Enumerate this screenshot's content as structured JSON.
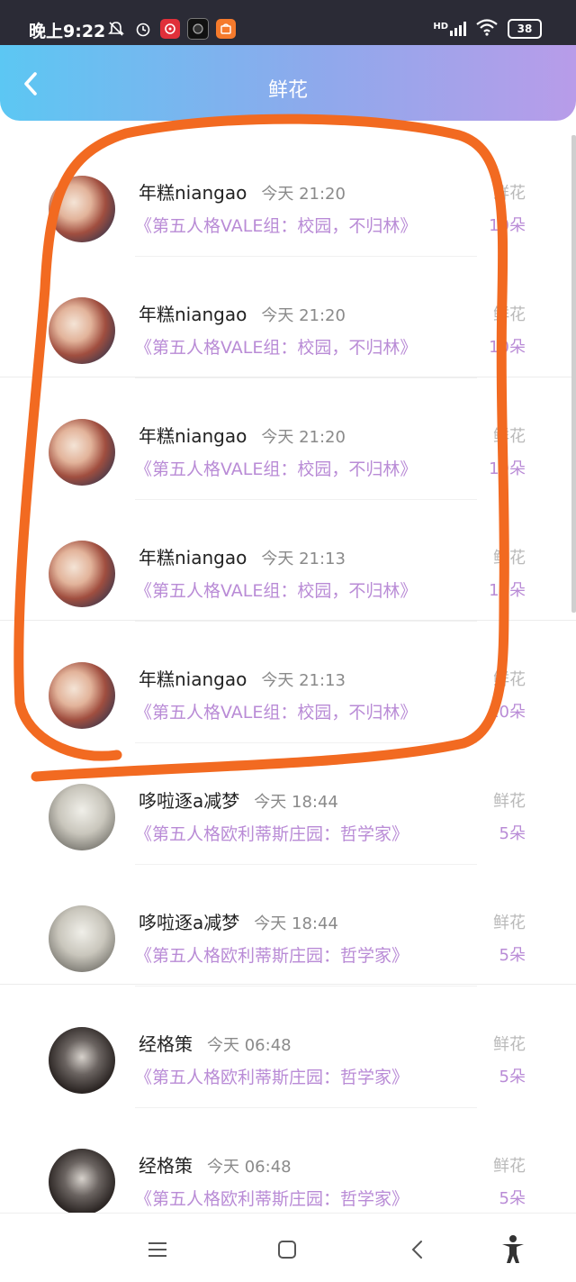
{
  "status_bar": {
    "time": "晚上9:22",
    "network": "HD",
    "battery": "38"
  },
  "header": {
    "title": "鲜花"
  },
  "list": [
    {
      "avatar": "anime-avatar",
      "name": "年糕niangao",
      "time": "今天 21:20",
      "subject": "《第五人格VALE组：校园，不归林》",
      "gift_label": "鲜花",
      "gift_count": "10朵"
    },
    {
      "avatar": "anime-avatar",
      "name": "年糕niangao",
      "time": "今天 21:20",
      "subject": "《第五人格VALE组：校园，不归林》",
      "gift_label": "鲜花",
      "gift_count": "10朵"
    },
    {
      "avatar": "anime-avatar",
      "name": "年糕niangao",
      "time": "今天 21:20",
      "subject": "《第五人格VALE组：校园，不归林》",
      "gift_label": "鲜花",
      "gift_count": "10朵"
    },
    {
      "avatar": "anime-avatar",
      "name": "年糕niangao",
      "time": "今天 21:13",
      "subject": "《第五人格VALE组：校园，不归林》",
      "gift_label": "鲜花",
      "gift_count": "10朵"
    },
    {
      "avatar": "anime-avatar",
      "name": "年糕niangao",
      "time": "今天 21:13",
      "subject": "《第五人格VALE组：校园，不归林》",
      "gift_label": "鲜花",
      "gift_count": "10朵"
    },
    {
      "avatar": "umbrella-avatar",
      "name": "哆啦逐a减梦",
      "time": "今天 18:44",
      "subject": "《第五人格欧利蒂斯庄园：哲学家》",
      "gift_label": "鲜花",
      "gift_count": "5朵"
    },
    {
      "avatar": "umbrella-avatar",
      "name": "哆啦逐a减梦",
      "time": "今天 18:44",
      "subject": "《第五人格欧利蒂斯庄园：哲学家》",
      "gift_label": "鲜花",
      "gift_count": "5朵"
    },
    {
      "avatar": "dark-avatar",
      "name": "经格策",
      "time": "今天 06:48",
      "subject": "《第五人格欧利蒂斯庄园：哲学家》",
      "gift_label": "鲜花",
      "gift_count": "5朵"
    },
    {
      "avatar": "dark-avatar",
      "name": "经格策",
      "time": "今天 06:48",
      "subject": "《第五人格欧利蒂斯庄园：哲学家》",
      "gift_label": "鲜花",
      "gift_count": "5朵"
    }
  ],
  "colors": {
    "accent_purple": "#b98bd6",
    "header_gradient_start": "#5cc7f3",
    "header_gradient_end": "#b89ce9",
    "annotation_orange": "#f26a21"
  },
  "nav_bar": {
    "icons": [
      "menu-icon",
      "home-icon",
      "back-icon",
      "accessibility-icon"
    ]
  }
}
